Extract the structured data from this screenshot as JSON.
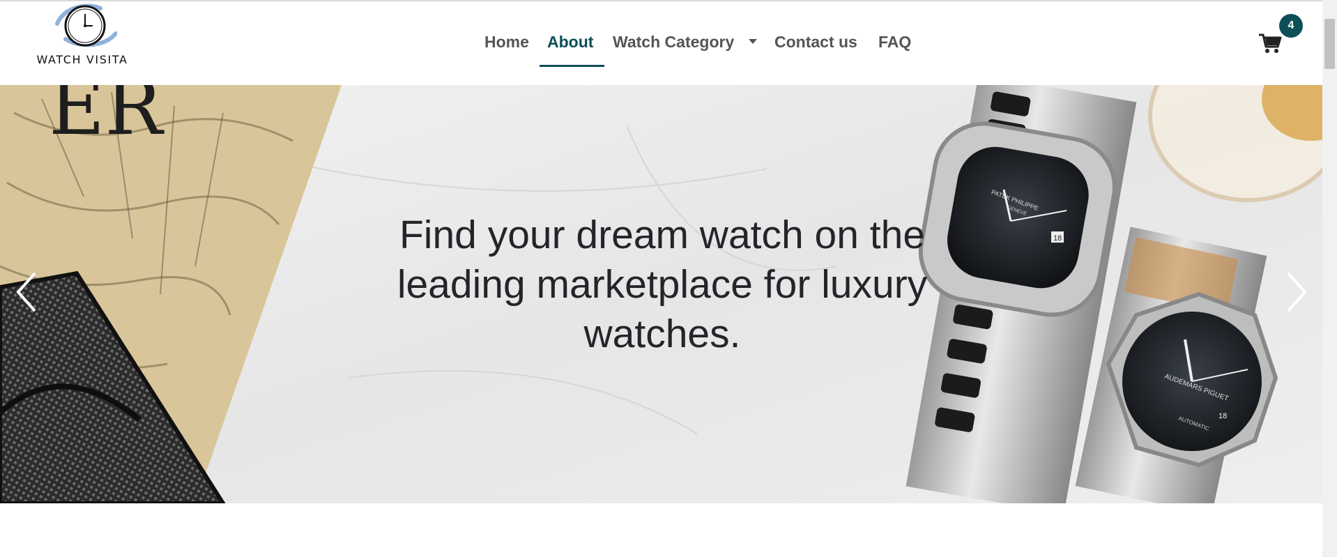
{
  "brand": {
    "name": "WATCH VISITA",
    "logo_icon": "wall-clock-logo-icon"
  },
  "nav": {
    "items": [
      {
        "label": "Home",
        "active": false
      },
      {
        "label": "About",
        "active": true
      },
      {
        "label": "Watch Category",
        "active": false,
        "dropdown": true
      },
      {
        "label": "Contact us",
        "active": false
      },
      {
        "label": "FAQ",
        "active": false
      }
    ]
  },
  "cart": {
    "icon": "shopping-cart-icon",
    "count": "4"
  },
  "hero": {
    "headline": "Find your dream watch on the leading marketplace for luxury watches.",
    "prev_icon": "chevron-left-icon",
    "next_icon": "chevron-right-icon",
    "watch_1_brand": "PATEK PHILIPPE",
    "watch_1_city": "GENEVE",
    "watch_1_date": "18",
    "watch_2_brand": "AUDEMARS PIGUET",
    "watch_2_movement": "AUTOMATIC",
    "watch_2_date": "18"
  },
  "colors": {
    "accent": "#0d4f57",
    "nav_text": "#555555",
    "headline": "#24252a"
  }
}
